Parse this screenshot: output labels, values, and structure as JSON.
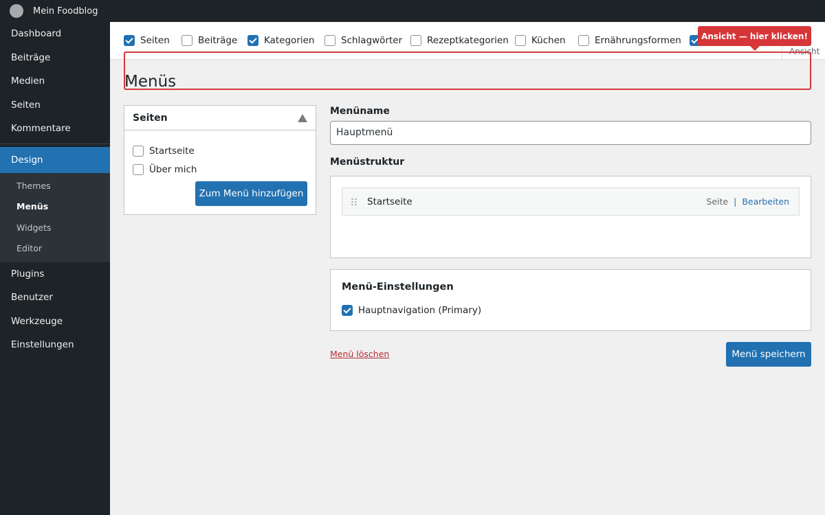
{
  "adminbar": {
    "site_name": "Mein Foodblog"
  },
  "sidebar": {
    "items_top": [
      "Dashboard",
      "Beiträge",
      "Medien",
      "Seiten",
      "Kommentare"
    ],
    "active": "Design",
    "submenu": [
      "Themes",
      "Menüs",
      "Widgets",
      "Editor"
    ],
    "current_sub": "Menüs",
    "items_bottom": [
      "Plugins",
      "Benutzer",
      "Werkzeuge",
      "Einstellungen"
    ]
  },
  "screen_options": {
    "options": [
      {
        "label": "Seiten",
        "checked": true
      },
      {
        "label": "Beiträge",
        "checked": false
      },
      {
        "label": "Kategorien",
        "checked": true
      },
      {
        "label": "Schlagwörter",
        "checked": false
      },
      {
        "label": "Rezeptkategorien",
        "checked": false
      },
      {
        "label": "Küchen",
        "checked": false
      },
      {
        "label": "Ernährungsformen",
        "checked": false
      },
      {
        "label": "",
        "checked": true
      }
    ],
    "tab_label": "Ansicht"
  },
  "callout": {
    "text": "Ansicht — hier klicken!"
  },
  "page": {
    "title": "Menüs"
  },
  "pages_box": {
    "title": "Seiten",
    "items": [
      "Startseite",
      "Über mich"
    ],
    "add_button": "Zum Menü hinzufügen"
  },
  "menu_name": {
    "label": "Menüname",
    "value": "Hauptmenü"
  },
  "structure": {
    "label": "Menüstruktur",
    "entry_title": "Startseite",
    "entry_type": "Seite",
    "entry_sep": "|",
    "entry_edit": "Bearbeiten"
  },
  "settings": {
    "title": "Menü-Einstellungen",
    "location_label": "Hauptnavigation (Primary)",
    "location_checked": true
  },
  "actions": {
    "delete": "Menü löschen",
    "save": "Menü speichern"
  },
  "colors": {
    "accent": "#2271b1",
    "sidebar_bg": "#1d2327",
    "callout": "#d63638"
  }
}
